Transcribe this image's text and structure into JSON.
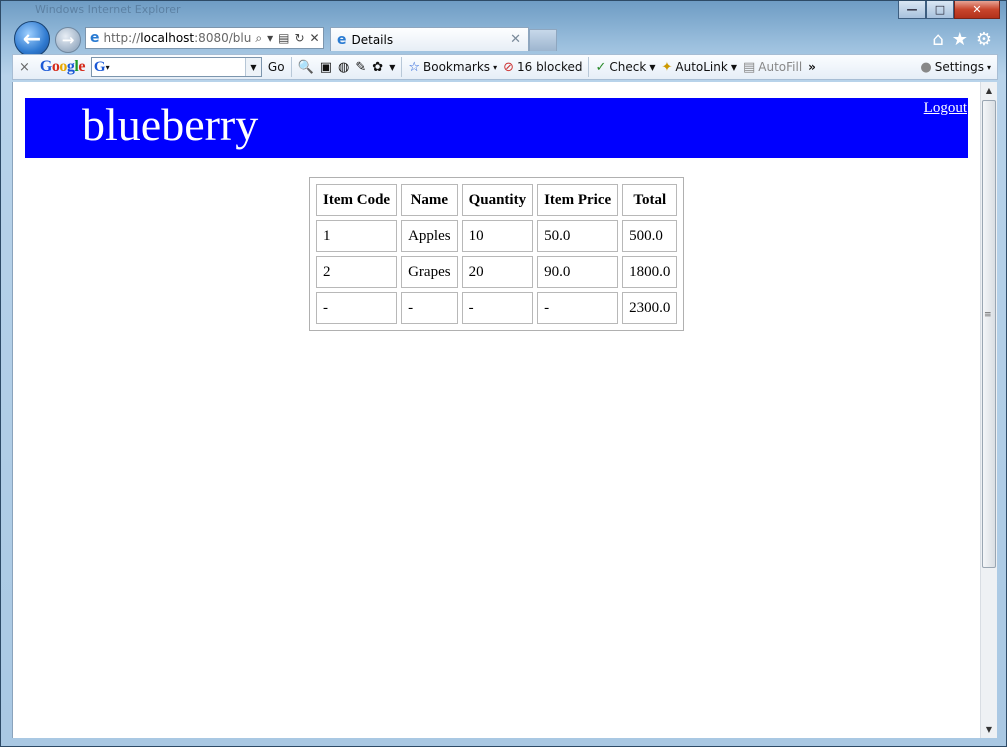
{
  "window": {
    "title": "Windows Internet Explorer",
    "controls": {
      "minimize": "—",
      "maximize": "□",
      "close": "✕"
    }
  },
  "nav": {
    "address_prefix": "http://",
    "address_host": "localhost",
    "address_rest": ":8080/blu",
    "tab_label": "Details"
  },
  "toolbar": {
    "close": "×",
    "google_letters": [
      "G",
      "o",
      "o",
      "g",
      "l",
      "e"
    ],
    "search_g": "G",
    "go_label": "Go",
    "bookmarks_label": "Bookmarks",
    "blocked_label": "16 blocked",
    "check_label": "Check",
    "autolink_label": "AutoLink",
    "autofill_label": "AutoFill",
    "more_label": "»",
    "settings_label": "Settings"
  },
  "page": {
    "brand": "blueberry",
    "logout": "Logout",
    "banner_color": "#0000ff"
  },
  "table": {
    "headers": [
      "Item Code",
      "Name",
      "Quantity",
      "Item Price",
      "Total"
    ],
    "rows": [
      [
        "1",
        "Apples",
        "10",
        "50.0",
        "500.0"
      ],
      [
        "2",
        "Grapes",
        "20",
        "90.0",
        "1800.0"
      ],
      [
        "-",
        "-",
        "-",
        "-",
        "2300.0"
      ]
    ]
  }
}
